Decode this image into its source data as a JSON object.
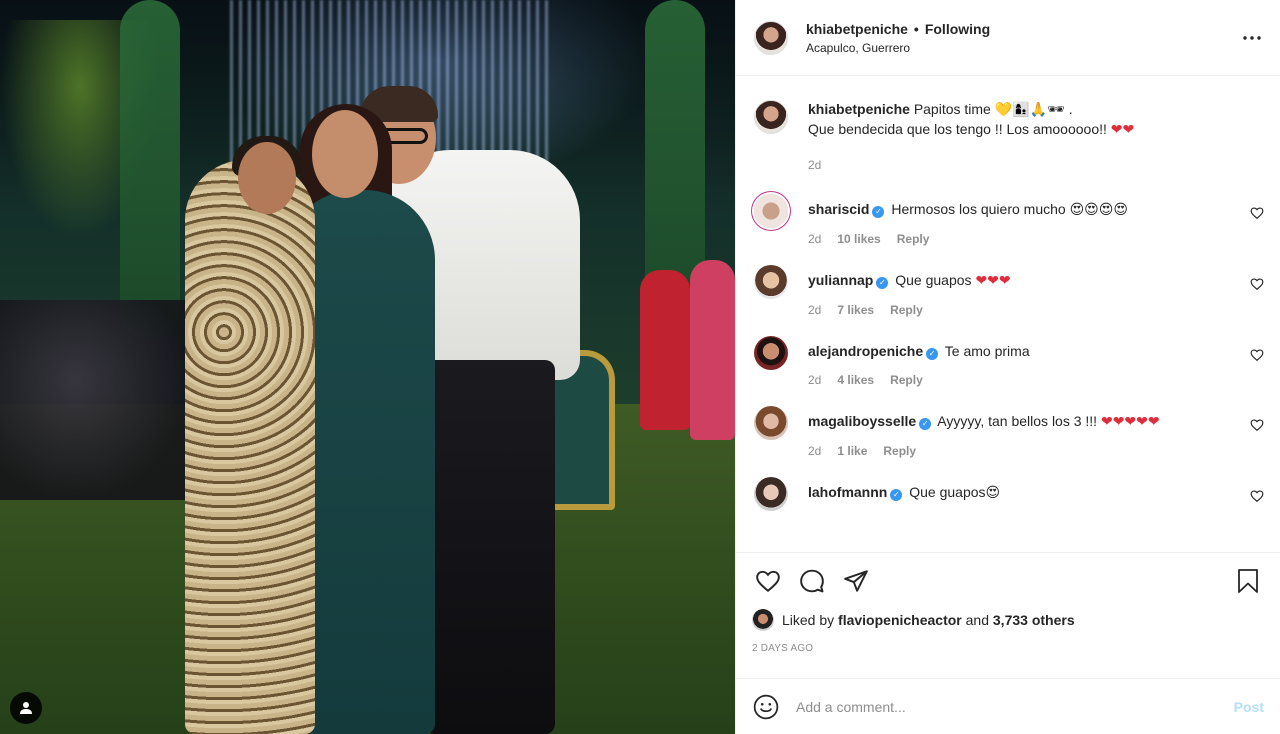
{
  "post": {
    "username": "khiabetpeniche",
    "separator": "•",
    "follow_state": "Following",
    "location": "Acapulco, Guerrero",
    "more_icon": "more-horizontal-icon"
  },
  "caption": {
    "username": "khiabetpeniche",
    "text_line1": "Papitos time",
    "emojis_line1": "💛👩‍👦🙏🕶",
    "period": ".",
    "text_line2": "Que bendecida que los tengo !! Los amoooooo!!",
    "hearts_line2": "❤❤",
    "age": "2d"
  },
  "comments": [
    {
      "username": "shariscid",
      "verified": true,
      "text": "Hermosos los quiero mucho",
      "emoji": "😍😍😍😍",
      "age": "2d",
      "likes": "10 likes",
      "reply": "Reply"
    },
    {
      "username": "yuliannap",
      "verified": true,
      "text": "Que guapos",
      "emoji": "❤❤❤",
      "age": "2d",
      "likes": "7 likes",
      "reply": "Reply"
    },
    {
      "username": "alejandropeniche",
      "verified": true,
      "text": "Te amo prima",
      "emoji": "",
      "age": "2d",
      "likes": "4 likes",
      "reply": "Reply"
    },
    {
      "username": "magaliboysselle",
      "verified": true,
      "text": "Ayyyyy, tan bellos los 3 !!!",
      "emoji": "❤❤❤❤❤",
      "age": "2d",
      "likes": "1 like",
      "reply": "Reply"
    },
    {
      "username": "lahofmannn",
      "verified": true,
      "text": "Que guapos",
      "emoji": "😍",
      "age": "",
      "likes": "",
      "reply": ""
    }
  ],
  "likes": {
    "prefix": "Liked by",
    "user": "flaviopenicheactor",
    "connector": "and",
    "others": "3,733 others"
  },
  "timestamp": "2 DAYS AGO",
  "add_comment": {
    "placeholder": "Add a comment...",
    "post_label": "Post"
  },
  "colors": {
    "accent_blue": "#3897f0",
    "post_disabled": "#b2dffc",
    "heart_red": "#e02d3c",
    "muted": "#8e8e8e"
  }
}
